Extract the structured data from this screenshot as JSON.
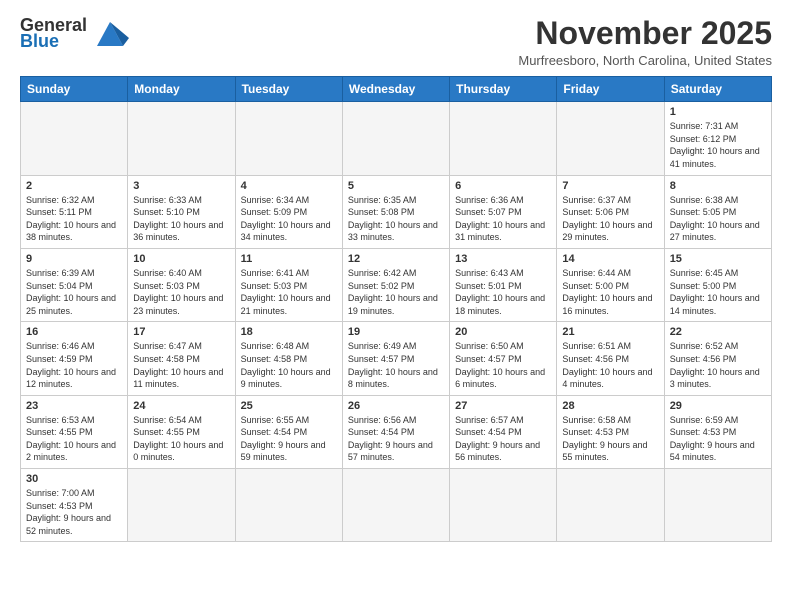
{
  "header": {
    "logo_line1": "General",
    "logo_line2": "Blue",
    "month_title": "November 2025",
    "subtitle": "Murfreesboro, North Carolina, United States"
  },
  "days_of_week": [
    "Sunday",
    "Monday",
    "Tuesday",
    "Wednesday",
    "Thursday",
    "Friday",
    "Saturday"
  ],
  "weeks": [
    [
      {
        "day": "",
        "info": ""
      },
      {
        "day": "",
        "info": ""
      },
      {
        "day": "",
        "info": ""
      },
      {
        "day": "",
        "info": ""
      },
      {
        "day": "",
        "info": ""
      },
      {
        "day": "",
        "info": ""
      },
      {
        "day": "1",
        "info": "Sunrise: 7:31 AM\nSunset: 6:12 PM\nDaylight: 10 hours and 41 minutes."
      }
    ],
    [
      {
        "day": "2",
        "info": "Sunrise: 6:32 AM\nSunset: 5:11 PM\nDaylight: 10 hours and 38 minutes."
      },
      {
        "day": "3",
        "info": "Sunrise: 6:33 AM\nSunset: 5:10 PM\nDaylight: 10 hours and 36 minutes."
      },
      {
        "day": "4",
        "info": "Sunrise: 6:34 AM\nSunset: 5:09 PM\nDaylight: 10 hours and 34 minutes."
      },
      {
        "day": "5",
        "info": "Sunrise: 6:35 AM\nSunset: 5:08 PM\nDaylight: 10 hours and 33 minutes."
      },
      {
        "day": "6",
        "info": "Sunrise: 6:36 AM\nSunset: 5:07 PM\nDaylight: 10 hours and 31 minutes."
      },
      {
        "day": "7",
        "info": "Sunrise: 6:37 AM\nSunset: 5:06 PM\nDaylight: 10 hours and 29 minutes."
      },
      {
        "day": "8",
        "info": "Sunrise: 6:38 AM\nSunset: 5:05 PM\nDaylight: 10 hours and 27 minutes."
      }
    ],
    [
      {
        "day": "9",
        "info": "Sunrise: 6:39 AM\nSunset: 5:04 PM\nDaylight: 10 hours and 25 minutes."
      },
      {
        "day": "10",
        "info": "Sunrise: 6:40 AM\nSunset: 5:03 PM\nDaylight: 10 hours and 23 minutes."
      },
      {
        "day": "11",
        "info": "Sunrise: 6:41 AM\nSunset: 5:03 PM\nDaylight: 10 hours and 21 minutes."
      },
      {
        "day": "12",
        "info": "Sunrise: 6:42 AM\nSunset: 5:02 PM\nDaylight: 10 hours and 19 minutes."
      },
      {
        "day": "13",
        "info": "Sunrise: 6:43 AM\nSunset: 5:01 PM\nDaylight: 10 hours and 18 minutes."
      },
      {
        "day": "14",
        "info": "Sunrise: 6:44 AM\nSunset: 5:00 PM\nDaylight: 10 hours and 16 minutes."
      },
      {
        "day": "15",
        "info": "Sunrise: 6:45 AM\nSunset: 5:00 PM\nDaylight: 10 hours and 14 minutes."
      }
    ],
    [
      {
        "day": "16",
        "info": "Sunrise: 6:46 AM\nSunset: 4:59 PM\nDaylight: 10 hours and 12 minutes."
      },
      {
        "day": "17",
        "info": "Sunrise: 6:47 AM\nSunset: 4:58 PM\nDaylight: 10 hours and 11 minutes."
      },
      {
        "day": "18",
        "info": "Sunrise: 6:48 AM\nSunset: 4:58 PM\nDaylight: 10 hours and 9 minutes."
      },
      {
        "day": "19",
        "info": "Sunrise: 6:49 AM\nSunset: 4:57 PM\nDaylight: 10 hours and 8 minutes."
      },
      {
        "day": "20",
        "info": "Sunrise: 6:50 AM\nSunset: 4:57 PM\nDaylight: 10 hours and 6 minutes."
      },
      {
        "day": "21",
        "info": "Sunrise: 6:51 AM\nSunset: 4:56 PM\nDaylight: 10 hours and 4 minutes."
      },
      {
        "day": "22",
        "info": "Sunrise: 6:52 AM\nSunset: 4:56 PM\nDaylight: 10 hours and 3 minutes."
      }
    ],
    [
      {
        "day": "23",
        "info": "Sunrise: 6:53 AM\nSunset: 4:55 PM\nDaylight: 10 hours and 2 minutes."
      },
      {
        "day": "24",
        "info": "Sunrise: 6:54 AM\nSunset: 4:55 PM\nDaylight: 10 hours and 0 minutes."
      },
      {
        "day": "25",
        "info": "Sunrise: 6:55 AM\nSunset: 4:54 PM\nDaylight: 9 hours and 59 minutes."
      },
      {
        "day": "26",
        "info": "Sunrise: 6:56 AM\nSunset: 4:54 PM\nDaylight: 9 hours and 57 minutes."
      },
      {
        "day": "27",
        "info": "Sunrise: 6:57 AM\nSunset: 4:54 PM\nDaylight: 9 hours and 56 minutes."
      },
      {
        "day": "28",
        "info": "Sunrise: 6:58 AM\nSunset: 4:53 PM\nDaylight: 9 hours and 55 minutes."
      },
      {
        "day": "29",
        "info": "Sunrise: 6:59 AM\nSunset: 4:53 PM\nDaylight: 9 hours and 54 minutes."
      }
    ],
    [
      {
        "day": "30",
        "info": "Sunrise: 7:00 AM\nSunset: 4:53 PM\nDaylight: 9 hours and 52 minutes."
      },
      {
        "day": "",
        "info": ""
      },
      {
        "day": "",
        "info": ""
      },
      {
        "day": "",
        "info": ""
      },
      {
        "day": "",
        "info": ""
      },
      {
        "day": "",
        "info": ""
      },
      {
        "day": "",
        "info": ""
      }
    ]
  ]
}
